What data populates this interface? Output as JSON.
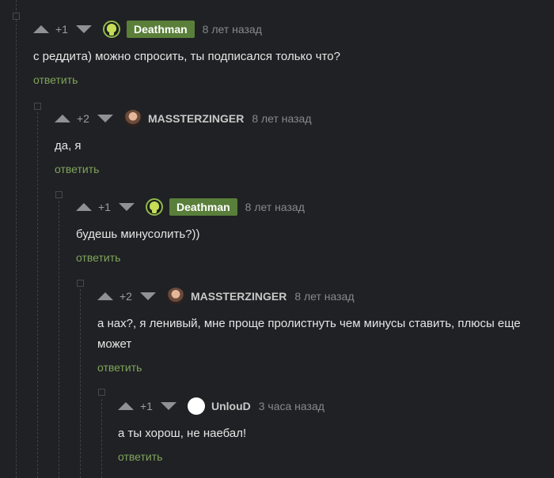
{
  "comments": [
    {
      "rating": "+1",
      "author": "Deathman",
      "time": "8 лет назад",
      "text": "с реддита) можно спросить, ты подписался только что?",
      "reply": "ответить"
    },
    {
      "rating": "+2",
      "author": "MASSTERZINGER",
      "time": "8 лет назад",
      "text": "да, я",
      "reply": "ответить"
    },
    {
      "rating": "+1",
      "author": "Deathman",
      "time": "8 лет назад",
      "text": "будешь минусолить?))",
      "reply": "ответить"
    },
    {
      "rating": "+2",
      "author": "MASSTERZINGER",
      "time": "8 лет назад",
      "text": "а нах?, я ленивый, мне проще пролистнуть чем минусы ставить, плюсы еще может",
      "reply": "ответить"
    },
    {
      "rating": "+1",
      "author": "UnlouD",
      "time": "3 часа назад",
      "text": "а ты хорош, не наебал!",
      "reply": "ответить"
    }
  ],
  "colors": {
    "background": "#202124",
    "author_badge": "#5a7f3a",
    "reply_link": "#7fa55b"
  },
  "icons": [
    "arrow-up-icon",
    "arrow-down-icon",
    "skull-avatar-icon",
    "user-photo-avatar",
    "blank-avatar"
  ]
}
